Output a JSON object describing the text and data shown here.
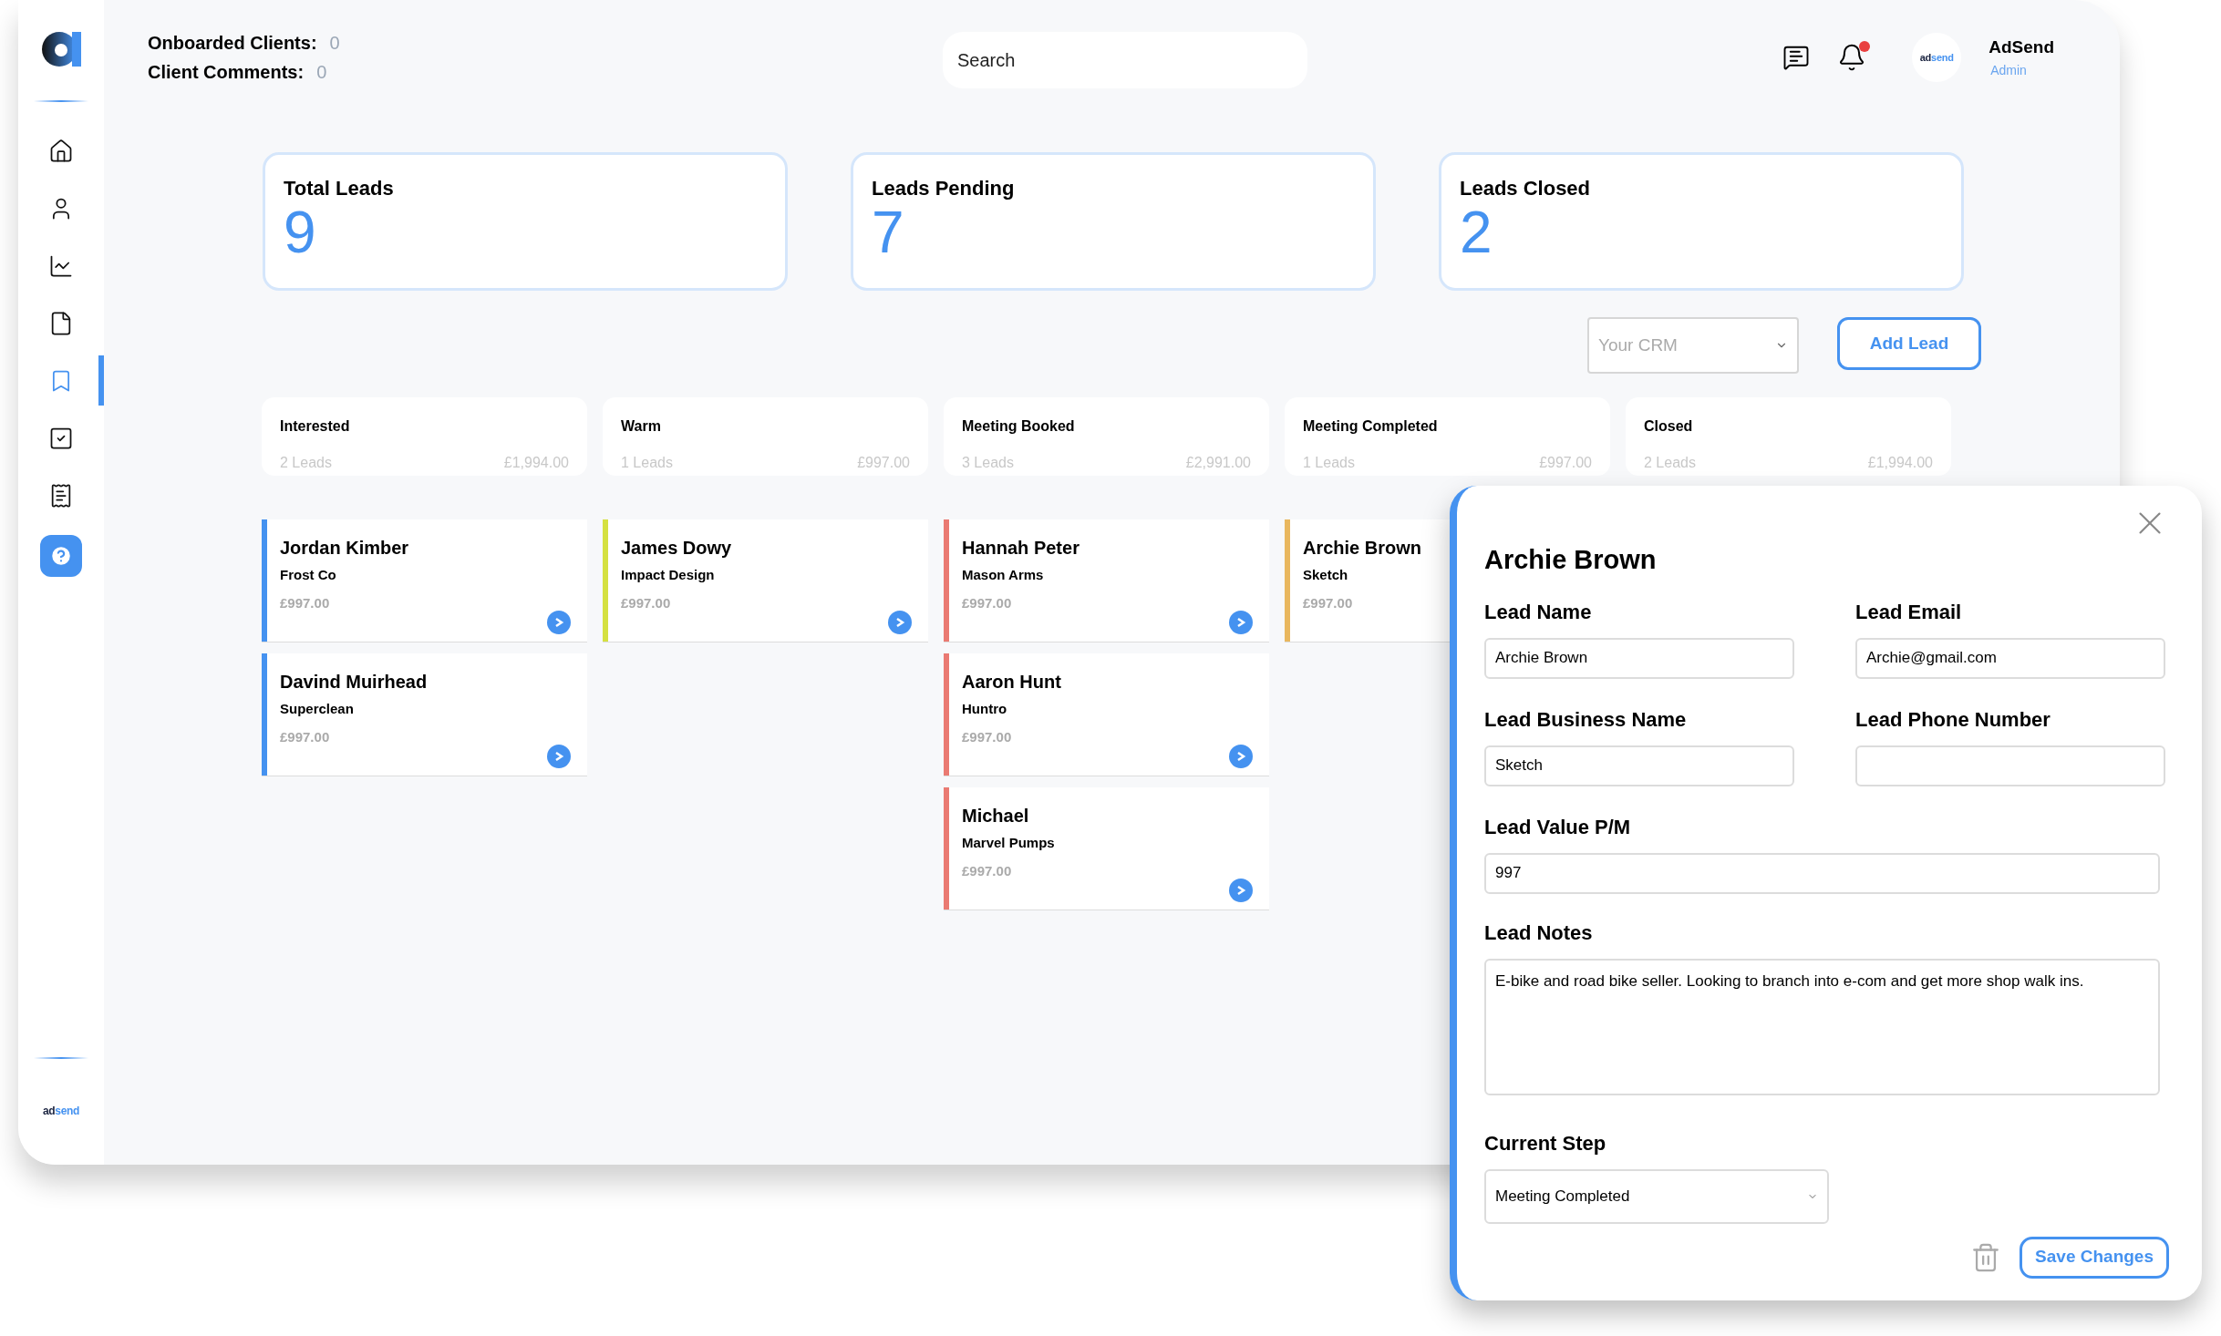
{
  "sidebar": {
    "items": [
      {
        "selected": false
      },
      {
        "selected": false
      },
      {
        "selected": false
      },
      {
        "selected": false
      },
      {
        "selected": true
      },
      {
        "selected": false
      },
      {
        "selected": false
      }
    ],
    "brand": "adsend"
  },
  "header": {
    "stats": [
      {
        "label": "Onboarded Clients:",
        "value": "0"
      },
      {
        "label": "Client Comments:",
        "value": "0"
      }
    ],
    "search": {
      "placeholder": "Search"
    },
    "notification": true,
    "user": {
      "avatar": "adsend",
      "name": "AdSend",
      "role": "Admin"
    }
  },
  "summary": [
    {
      "title": "Total Leads",
      "value": "9"
    },
    {
      "title": "Leads Pending",
      "value": "7"
    },
    {
      "title": "Leads Closed",
      "value": "2"
    }
  ],
  "crm_select": {
    "placeholder": "Your CRM"
  },
  "add_button": "Add Lead",
  "columns": [
    {
      "title": "Interested",
      "count": "2 Leads",
      "total": "£1,994.00",
      "cards": [
        {
          "name": "Jordan Kimber",
          "company": "Frost Co",
          "value": "£997.00",
          "color": "#4592f0"
        },
        {
          "name": "Davind Muirhead",
          "company": "Superclean",
          "value": "£997.00",
          "color": "#4592f0"
        }
      ]
    },
    {
      "title": "Warm",
      "count": "1 Leads",
      "total": "£997.00",
      "cards": [
        {
          "name": "James Dowy",
          "company": "Impact Design",
          "value": "£997.00",
          "color": "#d5e140"
        }
      ]
    },
    {
      "title": "Meeting Booked",
      "count": "3 Leads",
      "total": "£2,991.00",
      "cards": [
        {
          "name": "Hannah Peter",
          "company": "Mason Arms",
          "value": "£997.00",
          "color": "#ea7a72"
        },
        {
          "name": "Aaron Hunt",
          "company": "Huntro",
          "value": "£997.00",
          "color": "#ea7a72"
        },
        {
          "name": "Michael",
          "company": "Marvel Pumps",
          "value": "£997.00",
          "color": "#ea7a72"
        }
      ]
    },
    {
      "title": "Meeting Completed",
      "count": "1 Leads",
      "total": "£997.00",
      "cards": [
        {
          "name": "Archie Brown",
          "company": "Sketch",
          "value": "£997.00",
          "color": "#e9b75e",
          "open_button": false
        }
      ]
    },
    {
      "title": "Closed",
      "count": "2 Leads",
      "total": "£1,994.00"
    }
  ],
  "modal": {
    "title": "Archie Brown",
    "fields": [
      {
        "label": "Lead Name",
        "value": "Archie Brown"
      },
      {
        "label": "Lead Email",
        "value": "Archie@gmail.com"
      },
      {
        "label": "Lead Business Name",
        "value": "Sketch"
      },
      {
        "label": "Lead Phone Number"
      }
    ],
    "value_field": {
      "label": "Lead Value P/M",
      "value": "997"
    },
    "notes": {
      "label": "Lead Notes",
      "value": "E-bike and road bike seller. Looking to branch into e-com and get more shop walk ins."
    },
    "step": {
      "label": "Current Step",
      "value": "Meeting Completed"
    },
    "save_button": "Save Changes"
  }
}
